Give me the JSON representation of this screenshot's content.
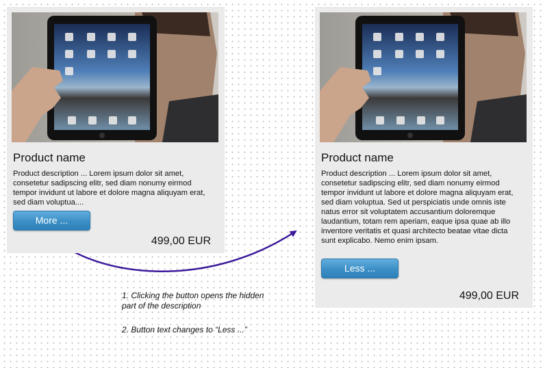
{
  "left_card": {
    "product_name": "Product name",
    "description": "Product description   ... Lorem ipsum dolor sit amet, consetetur sadipscing elitr, sed diam nonumy eirmod tempor invidunt ut labore et dolore magna aliquyam erat, sed diam voluptua....",
    "button_label": "More ...",
    "price": "499,00 EUR"
  },
  "right_card": {
    "product_name": "Product name",
    "description": "Product description   ... Lorem ipsum dolor sit amet, consetetur sadipscing elitr, sed diam nonumy eirmod tempor invidunt ut labore et dolore magna aliquyam erat, sed diam voluptua. Sed ut perspiciatis unde omnis iste natus error sit voluptatem accusantium doloremque laudantium, totam rem aperiam, eaque ipsa quae ab illo inventore veritatis et quasi architecto beatae vitae dicta sunt explicabo. Nemo enim ipsam.",
    "button_label": "Less ...",
    "price": "499,00 EUR"
  },
  "annotations": {
    "note_1": "1. Clicking the button opens the hidden part of the description",
    "note_2": "2. Button text changes to “Less ...”"
  },
  "colors": {
    "button": "#3b8fc6",
    "card_background": "#ebebeb",
    "arrow": "#3d1a9a"
  }
}
